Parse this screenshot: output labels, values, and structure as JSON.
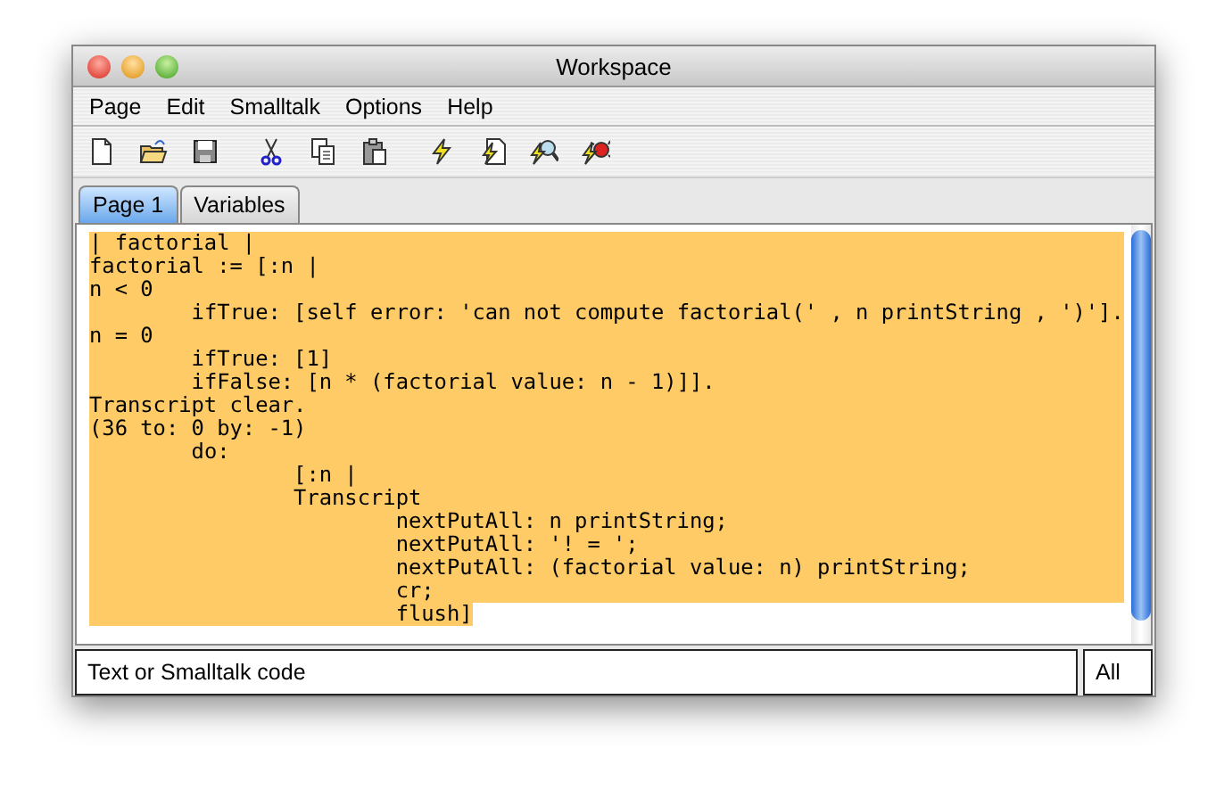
{
  "window": {
    "title": "Workspace"
  },
  "menu": [
    "Page",
    "Edit",
    "Smalltalk",
    "Options",
    "Help"
  ],
  "toolbar": [
    {
      "kind": "new"
    },
    {
      "kind": "open"
    },
    {
      "kind": "save"
    },
    {
      "kind": "cut"
    },
    {
      "kind": "copy"
    },
    {
      "kind": "paste"
    },
    {
      "kind": "do"
    },
    {
      "kind": "print"
    },
    {
      "kind": "inspect"
    },
    {
      "kind": "debug"
    }
  ],
  "tabs": [
    {
      "label": "Page 1",
      "selected": true
    },
    {
      "label": "Variables",
      "selected": false
    }
  ],
  "editor": {
    "selected": true,
    "lines": [
      "| factorial |",
      "factorial := [:n |",
      "n < 0",
      "\tifTrue: [self error: 'can not compute factorial(' , n printString , ')'].",
      "n = 0",
      "\tifTrue: [1]",
      "\tifFalse: [n * (factorial value: n - 1)]].",
      "Transcript clear.",
      "(36 to: 0 by: -1)",
      "\tdo:",
      "\t\t[:n |",
      "\t\tTranscript",
      "\t\t\tnextPutAll: n printString;",
      "\t\t\tnextPutAll: '! = ';",
      "\t\t\tnextPutAll: (factorial value: n) printString;",
      "\t\t\tcr;",
      "\t\t\tflush]"
    ]
  },
  "bottom": {
    "field": "Text or Smalltalk code",
    "button": "All"
  }
}
